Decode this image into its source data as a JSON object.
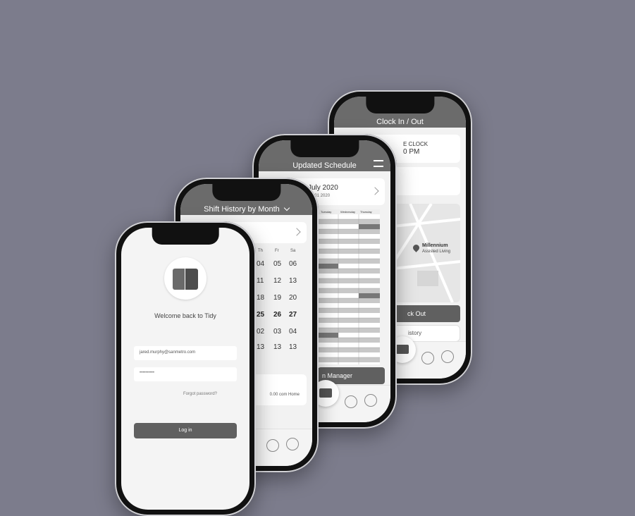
{
  "login": {
    "welcome": "Welcome back to Tidy",
    "email_value": "jared.murphy@sanmetro.com",
    "password_value": "••••••••••",
    "forgot": "Forgot password?",
    "login_button": "Log in"
  },
  "shift_history": {
    "title": "Shift History by Month",
    "weekday_headers": [
      "Th",
      "Fr",
      "Sa"
    ],
    "rows": [
      [
        "04",
        "05",
        "06"
      ],
      [
        "11",
        "12",
        "13"
      ],
      [
        "18",
        "19",
        "20"
      ],
      [
        "25",
        "26",
        "27"
      ],
      [
        "02",
        "03",
        "04"
      ],
      [
        "13",
        "13",
        "13"
      ]
    ],
    "footer_text": "0.00 com Home"
  },
  "schedule": {
    "title": "Updated Schedule",
    "month_label": "July 2020",
    "sub_label": "Jul 01 2020",
    "column_headers": [
      "Tuesday",
      "Wednesday",
      "Thursday"
    ],
    "message_button": "n Manager"
  },
  "clock": {
    "title": "Clock In / Out",
    "card_title": "E CLOCK",
    "card_time": "0 PM",
    "location_name": "Millennium",
    "location_sub": "Assisted Living",
    "clock_out_button": "ck Out",
    "history_link": "istory"
  },
  "colors": {
    "background": "#7c7c8c",
    "header": "#6b6b6b",
    "button": "#606060"
  }
}
